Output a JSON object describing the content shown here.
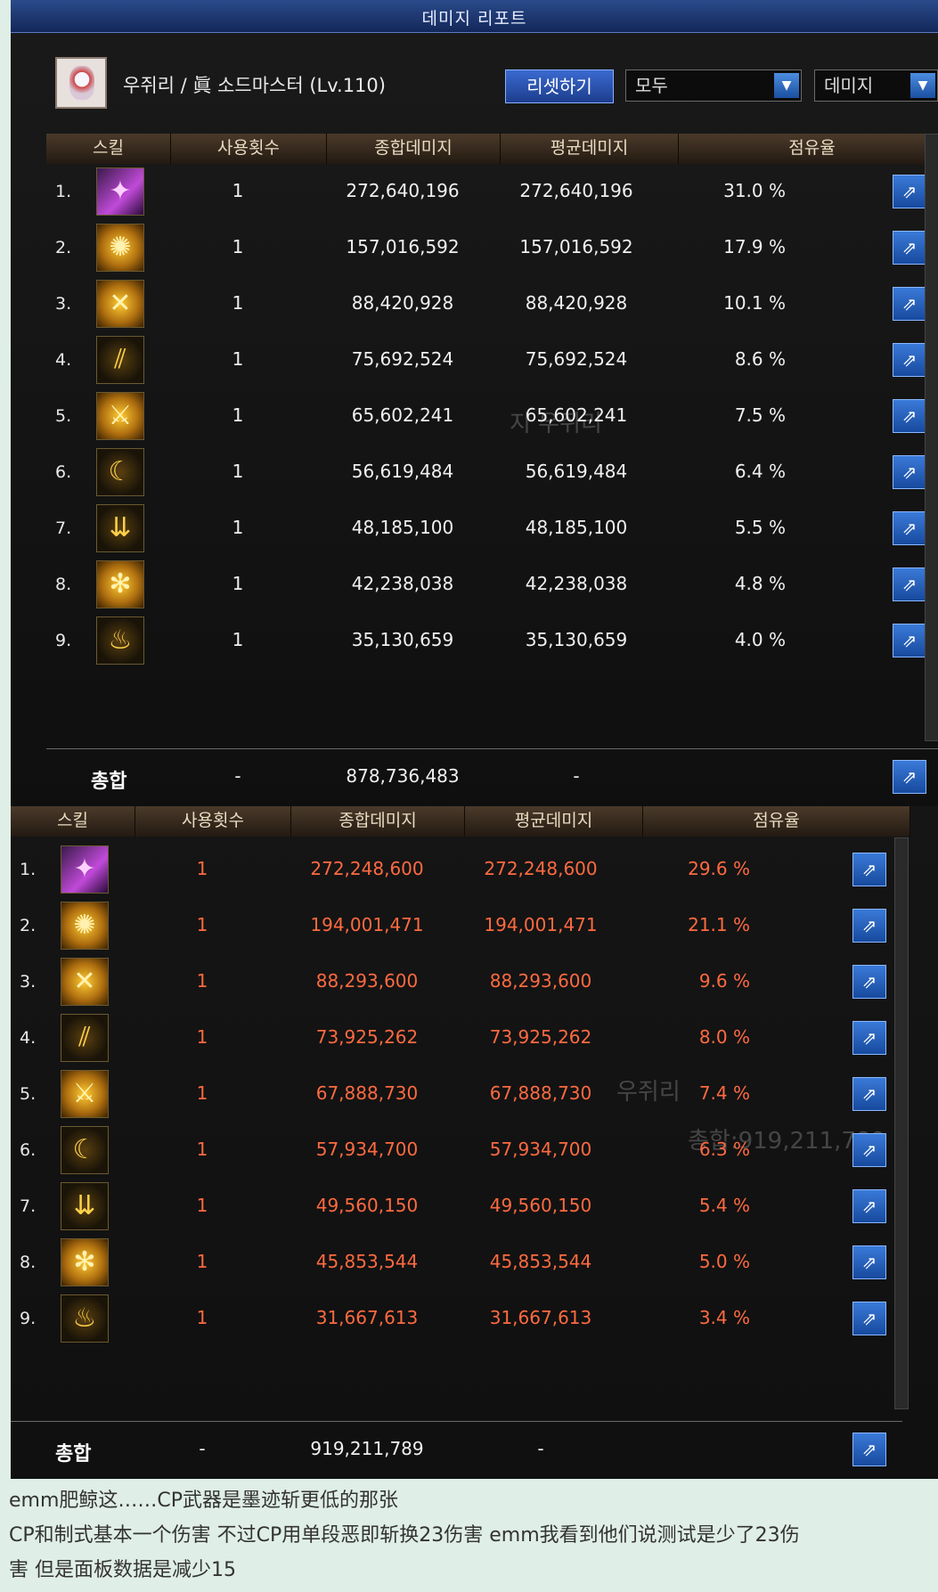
{
  "panel1": {
    "title": "데미지 리포트",
    "character": "우쥐리 / 眞 소드마스터 (Lv.110)",
    "reset_label": "리셋하기",
    "filter1": "모두",
    "filter2": "데미지",
    "columns": [
      "스킬",
      "사용횟수",
      "종합데미지",
      "평균데미지",
      "점유율"
    ],
    "rows": [
      {
        "rank": "1.",
        "icon": "dancer-skill-icon",
        "uses": "1",
        "total": "272,640,196",
        "avg": "272,640,196",
        "share": "31.0 %"
      },
      {
        "rank": "2.",
        "icon": "burst-skill-icon",
        "uses": "1",
        "total": "157,016,592",
        "avg": "157,016,592",
        "share": "17.9 %"
      },
      {
        "rank": "3.",
        "icon": "cross-slash-icon",
        "uses": "1",
        "total": "88,420,928",
        "avg": "88,420,928",
        "share": "10.1 %"
      },
      {
        "rank": "4.",
        "icon": "claw-slash-icon",
        "uses": "1",
        "total": "75,692,524",
        "avg": "75,692,524",
        "share": "8.6 %"
      },
      {
        "rank": "5.",
        "icon": "sword-icon",
        "uses": "1",
        "total": "65,602,241",
        "avg": "65,602,241",
        "share": "7.5 %"
      },
      {
        "rank": "6.",
        "icon": "crescent-icon",
        "uses": "1",
        "total": "56,619,484",
        "avg": "56,619,484",
        "share": "6.4 %"
      },
      {
        "rank": "7.",
        "icon": "swords-rain-icon",
        "uses": "1",
        "total": "48,185,100",
        "avg": "48,185,100",
        "share": "5.5 %"
      },
      {
        "rank": "8.",
        "icon": "vortex-icon",
        "uses": "1",
        "total": "42,238,038",
        "avg": "42,238,038",
        "share": "4.8 %"
      },
      {
        "rank": "9.",
        "icon": "flame-sword-icon",
        "uses": "1",
        "total": "35,130,659",
        "avg": "35,130,659",
        "share": "4.0 %"
      }
    ],
    "total": {
      "label": "총합",
      "uses": "-",
      "total": "878,736,483",
      "avg": "-"
    }
  },
  "panel2": {
    "columns": [
      "스킬",
      "사용횟수",
      "종합데미지",
      "평균데미지",
      "점유율"
    ],
    "rows": [
      {
        "rank": "1.",
        "icon": "dancer-skill-icon",
        "uses": "1",
        "total": "272,248,600",
        "avg": "272,248,600",
        "share": "29.6 %"
      },
      {
        "rank": "2.",
        "icon": "burst-skill-icon",
        "uses": "1",
        "total": "194,001,471",
        "avg": "194,001,471",
        "share": "21.1 %"
      },
      {
        "rank": "3.",
        "icon": "cross-slash-icon",
        "uses": "1",
        "total": "88,293,600",
        "avg": "88,293,600",
        "share": "9.6 %"
      },
      {
        "rank": "4.",
        "icon": "claw-slash-icon",
        "uses": "1",
        "total": "73,925,262",
        "avg": "73,925,262",
        "share": "8.0 %"
      },
      {
        "rank": "5.",
        "icon": "sword-icon",
        "uses": "1",
        "total": "67,888,730",
        "avg": "67,888,730",
        "share": "7.4 %"
      },
      {
        "rank": "6.",
        "icon": "crescent-icon",
        "uses": "1",
        "total": "57,934,700",
        "avg": "57,934,700",
        "share": "6.3 %"
      },
      {
        "rank": "7.",
        "icon": "swords-rain-icon",
        "uses": "1",
        "total": "49,560,150",
        "avg": "49,560,150",
        "share": "5.4 %"
      },
      {
        "rank": "8.",
        "icon": "vortex-icon",
        "uses": "1",
        "total": "45,853,544",
        "avg": "45,853,544",
        "share": "5.0 %"
      },
      {
        "rank": "9.",
        "icon": "flame-sword-icon",
        "uses": "1",
        "total": "31,667,613",
        "avg": "31,667,613",
        "share": "3.4 %"
      }
    ],
    "total": {
      "label": "총합",
      "uses": "-",
      "total": "919,211,789",
      "avg": "-"
    }
  },
  "caption": {
    "line1": "emm肥鲸这……CP武器是墨迹斩更低的那张",
    "line2": "CP和制式基本一个伤害   不过CP用单段恶即斩换23伤害  emm我看到他们说测试是少了23伤",
    "line3": "害  但是面板数据是减少15"
  }
}
